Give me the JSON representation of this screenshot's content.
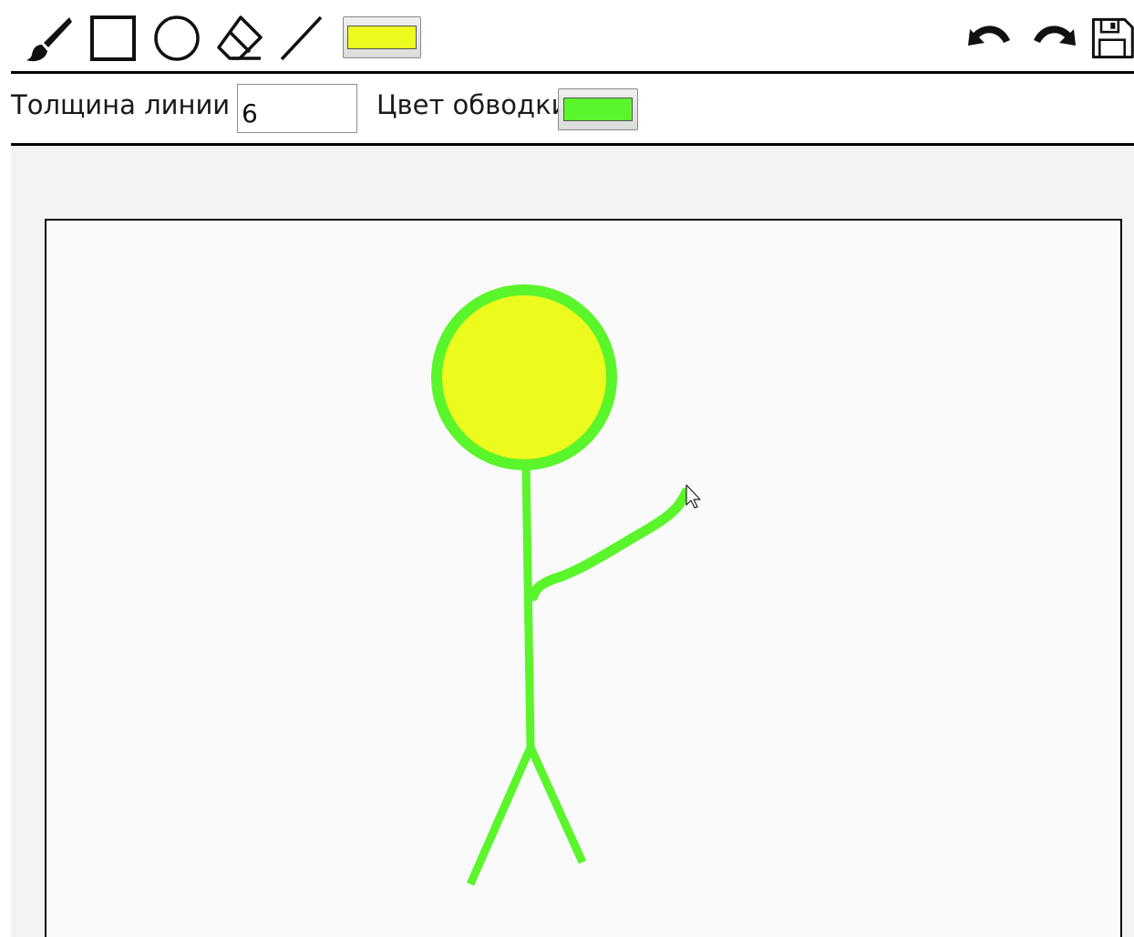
{
  "toolbar": {
    "tools": [
      {
        "name": "brush-tool",
        "icon": "brush-icon"
      },
      {
        "name": "rectangle-tool",
        "icon": "rectangle-icon"
      },
      {
        "name": "circle-tool",
        "icon": "circle-icon"
      },
      {
        "name": "eraser-tool",
        "icon": "eraser-icon"
      },
      {
        "name": "line-tool",
        "icon": "line-icon"
      }
    ],
    "fill_color": "#ecfa1e",
    "actions": [
      {
        "name": "undo-button",
        "icon": "undo-icon"
      },
      {
        "name": "redo-button",
        "icon": "redo-icon"
      },
      {
        "name": "save-button",
        "icon": "floppy-disk-icon"
      }
    ]
  },
  "settings": {
    "thickness_label": "Толщина линии",
    "thickness_value": "6",
    "stroke_label": "Цвет обводки",
    "stroke_color": "#5af52a"
  },
  "canvas": {
    "background": "#fafafa",
    "drawing": {
      "head": {
        "fill": "#ecfa1e",
        "stroke": "#5af52a"
      },
      "body_color": "#5af52a"
    }
  }
}
